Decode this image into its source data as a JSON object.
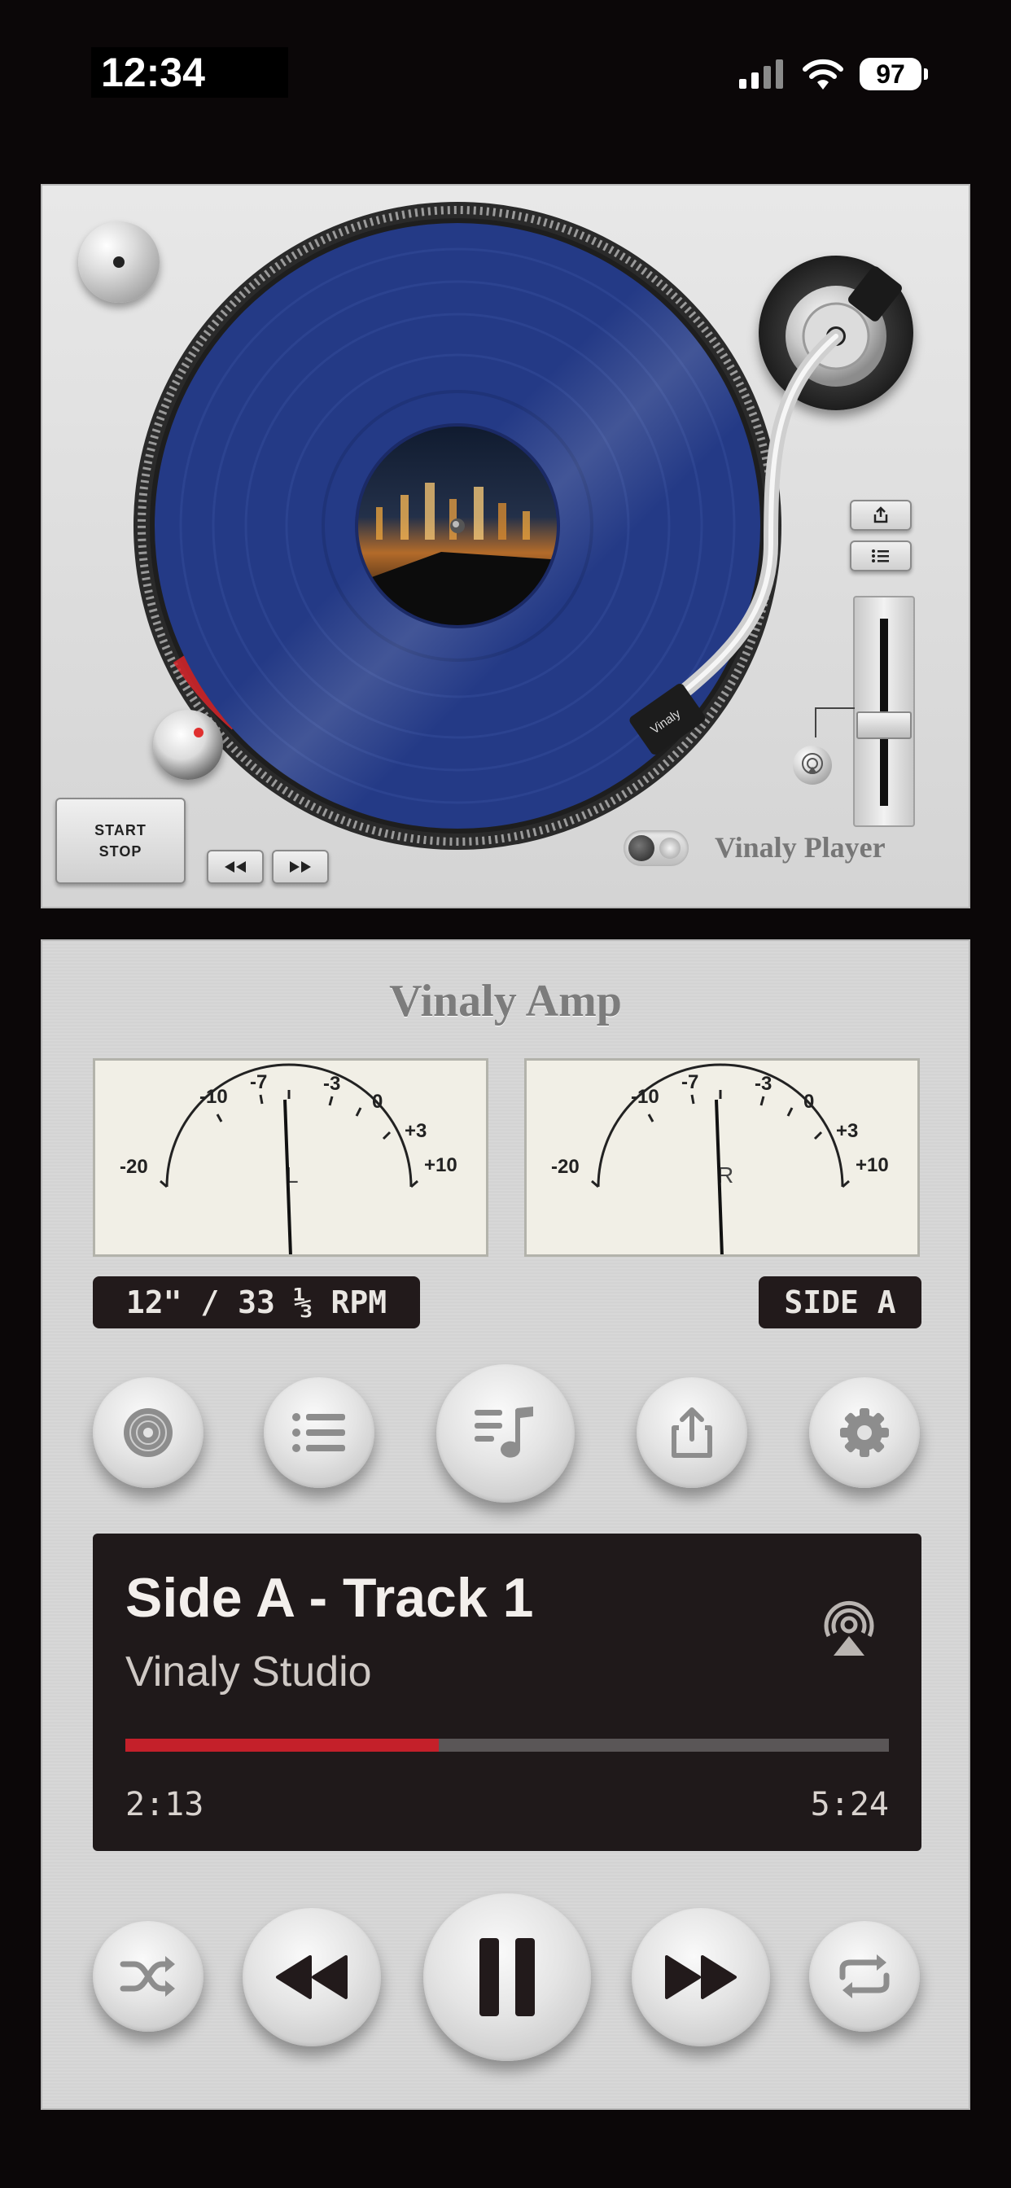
{
  "status_bar": {
    "time": "12:34",
    "battery": "97"
  },
  "deck": {
    "start_label": "START",
    "stop_label": "STOP",
    "brand": "Vinaly Player",
    "cartridge_label": "Vinaly"
  },
  "amp": {
    "title": "Vinaly Amp",
    "meter_scale": [
      "-20",
      "-10",
      "-7",
      "-3",
      "0",
      "+3",
      "+10"
    ],
    "meter_left_channel": "L",
    "meter_right_channel": "R",
    "format_label": "12\" / 33 ⅓ RPM",
    "side_label": "SIDE A"
  },
  "now_playing": {
    "title": "Side A - Track 1",
    "artist": "Vinaly Studio",
    "elapsed": "2:13",
    "duration": "5:24",
    "progress": 0.41
  },
  "colors": {
    "vinyl": "#243a86",
    "progress_fill": "#c4202a",
    "lcd_bg": "#221a1b"
  },
  "icons": {
    "function_row": [
      "disc-icon",
      "list-icon",
      "music-note-list-icon",
      "share-icon",
      "gear-icon"
    ],
    "transport_row": [
      "shuffle-icon",
      "rewind-icon",
      "pause-icon",
      "fast-forward-icon",
      "repeat-icon"
    ]
  }
}
